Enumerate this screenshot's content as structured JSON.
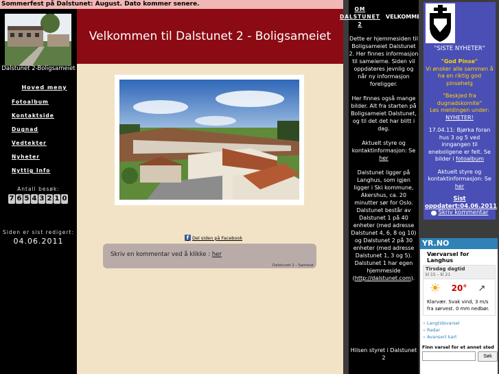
{
  "ticker": "Sommerfest på Dalstunet: August. Dato kommer senere.",
  "sidebar": {
    "logo_caption": "Dalstunet 2-Boligsameiet",
    "nav_header": "Hoved meny",
    "items": [
      "Fotoalbum",
      "Kontaktside",
      "Dugnad",
      "Vedtekter",
      "Nyheter",
      "Nyttig Info"
    ],
    "visits_label": "Antall besøk:",
    "visits_digits": [
      "7",
      "6",
      "5",
      "4",
      "3",
      "2",
      "1",
      "0"
    ],
    "edited_label": "Siden er sist redigert:",
    "edited_date": "04.06.2011"
  },
  "main": {
    "banner_title": "Velkommen til Dalstunet 2 - Boligsameiet",
    "facebook_link": "Del siden på Facebook",
    "comment_text": "Skriv en kommentar ved å klikke :",
    "comment_link": "her",
    "comment_sign": "Dalstunet 2 - Sameiet"
  },
  "about": {
    "header_link": "OM DALSTUNET 2",
    "header_title": "VELKOMMEN!",
    "p1": "Dette er hjemmesiden til Boligsameiet Dalstunet 2. Her finnes informasjon til sameierne. Siden vil oppdateres jevnlig og når ny informasjon foreligger.",
    "p2": "Her finnes også mange bilder. Alt fra starten på Boligsameiet Dalstunet, og til det det har blitt i dag.",
    "p3_text": "Aktuelt styre og kontaktinformasjon: Se",
    "p3_link": "her",
    "p4_text": "Dalstunet ligger på Langhus, som igjen ligger i Ski kommune, Akershus, ca. 20 minutter sør for Oslo. Dalstunet består av Dalstunet 1 på 40 enheter (med adresse Dalstunet 4, 6, 8 og 10) og Dalstunet 2 på 30 enheter (med adresse Dalstunet 1, 3 og 5). Dalstunet 1 har egen hjemmeside (",
    "p4_link": "http://dalstunet.com",
    "p4_end": ").",
    "footer": "Hilsen styret i Dalstunet 2"
  },
  "news": {
    "title": "\"SISTE NYHETER\"",
    "item1_title": "\"God Pinse\"",
    "item1_text": "Vi ønsker alle sammen å ha en riktig god pinsehelg",
    "item2_title": "\"Beskjed fra dugnadskomite\"",
    "item2_text": "Les meldingen under:",
    "item2_link": "NYHETER!",
    "item3_text": "17.04.11: Bjørka foran hus 3 og 5 ved inngangen til eneboligene er felt. Se bilder i",
    "item3_link": "fotoalbum",
    "item4_text": "Aktuelt styre og kontaktinformasjon: Se",
    "item4_link": "her",
    "updated_label": "Sist oppdatert:04.06.2011",
    "write_comment": "Skriv kommentar"
  },
  "weather": {
    "logo": "YR.NO",
    "title": "Værvarsel for Langhus",
    "day_label": "Tirsdag dagtid",
    "time_range": "kl 15 – kl 21",
    "temperature": "20°",
    "description": "Klarvær. Svak vind, 3 m/s fra sørvest. 0 mm nedbør.",
    "links": [
      "Langtidsvarsel",
      "Radar",
      "Avansert kart"
    ],
    "find_label": "Finn varsel for et annet sted",
    "search_button": "Søk"
  },
  "colors": {
    "banner": "#8b0a13",
    "news_bg": "#4a4fb5",
    "ticker_bg": "#f0b7b4",
    "page_bg": "#f3e3c6",
    "yr_blue": "#2f81b7"
  }
}
